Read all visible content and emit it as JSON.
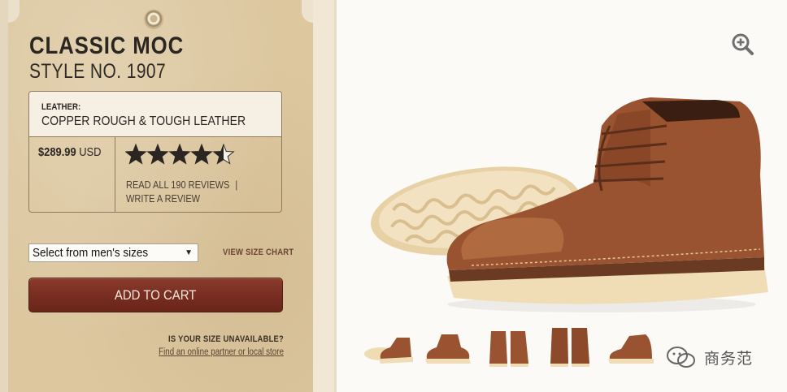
{
  "product": {
    "title": "CLASSIC MOC",
    "style_number": "STYLE NO. 1907",
    "leather_label": "LEATHER:",
    "leather_value": "COPPER ROUGH & TOUGH LEATHER",
    "price": "$289.99",
    "currency": "USD",
    "rating": 4.5,
    "rating_max": 5,
    "read_reviews_label": "READ ALL 190 REVIEWS",
    "review_separator": "|",
    "write_review_label": "WRITE A REVIEW"
  },
  "purchase": {
    "size_select_value": "Select from men's sizes",
    "size_chart_label": "VIEW SIZE CHART",
    "add_to_cart_label": "ADD TO CART",
    "size_unavailable_label": "IS YOUR SIZE UNAVAILABLE?",
    "find_partner_label": "Find an online partner or local store"
  },
  "gallery": {
    "zoom_icon": "zoom-in-icon",
    "thumbnail_count": 5
  },
  "watermark": {
    "text": "商务范",
    "icon": "wechat-icon"
  },
  "colors": {
    "tag": "#dcc79f",
    "button": "#7a2f22",
    "leather": "#9a5330",
    "sole": "#f1ddb5"
  }
}
